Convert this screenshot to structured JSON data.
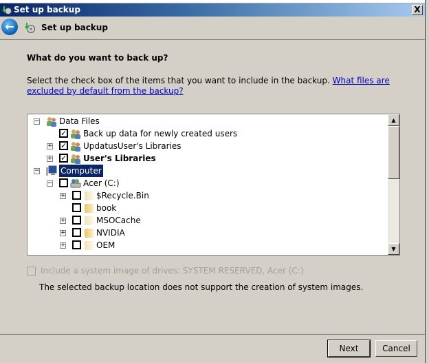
{
  "window": {
    "title": "Set up backup",
    "close_label": "X"
  },
  "header": {
    "title": "Set up backup",
    "back_label": "←"
  },
  "main": {
    "question": "What do you want to back up?",
    "description": "Select the check box of the items that you want to include in the backup. ",
    "excluded_link": "What files are excluded by default from the backup?",
    "tree": [
      {
        "label": "Data Files",
        "expander": "−",
        "icon": "users-icon"
      },
      {
        "label": "Back up data for newly created users",
        "checked": true,
        "icon": "users-icon"
      },
      {
        "label": "UpdatusUser's Libraries",
        "expander": "+",
        "checked": true,
        "icon": "users-icon"
      },
      {
        "label": "User's Libraries",
        "expander": "+",
        "checked": true,
        "bold": true,
        "icon": "users-icon"
      },
      {
        "label": "Computer",
        "expander": "−",
        "selected": true,
        "icon": "computer-icon"
      },
      {
        "label": "Acer (C:)",
        "expander": "−",
        "checked": false,
        "icon": "drive-icon"
      },
      {
        "label": "$Recycle.Bin",
        "expander": "+",
        "checked": false,
        "icon": "folder-icon"
      },
      {
        "label": "book",
        "checked": false,
        "icon": "folder-icon"
      },
      {
        "label": "MSOCache",
        "expander": "+",
        "checked": false,
        "icon": "folder-icon"
      },
      {
        "label": "NVIDIA",
        "expander": "+",
        "checked": false,
        "icon": "folder-icon"
      },
      {
        "label": "OEM",
        "expander": "+",
        "checked": false,
        "icon": "folder-icon"
      }
    ],
    "system_image_label": "Include a system image of drives: SYSTEM RESERVED, Acer (C:)",
    "system_image_checked": false,
    "note": "The selected backup location does not support the creation of system images."
  },
  "footer": {
    "next_label": "Next",
    "cancel_label": "Cancel"
  },
  "colors": {
    "selection": "#0a246a",
    "link": "#0000cc",
    "face": "#d4d0c8"
  }
}
